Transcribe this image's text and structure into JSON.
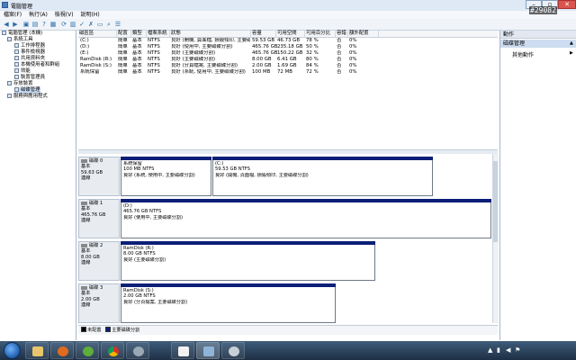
{
  "window": {
    "title": "電腦管理"
  },
  "menubar": [
    "檔案(F)",
    "執行(A)",
    "檢視(V)",
    "說明(H)"
  ],
  "tree": [
    {
      "label": "電腦管理 (本機)",
      "level": 0
    },
    {
      "label": "系統工具",
      "level": 1
    },
    {
      "label": "工作排程器",
      "level": 2
    },
    {
      "label": "事件檢視器",
      "level": 2
    },
    {
      "label": "共用資料夾",
      "level": 2
    },
    {
      "label": "本機使用者和群組",
      "level": 2
    },
    {
      "label": "效能",
      "level": 2
    },
    {
      "label": "裝置管理員",
      "level": 2
    },
    {
      "label": "存放裝置",
      "level": 1
    },
    {
      "label": "磁碟管理",
      "level": 2,
      "selected": true
    },
    {
      "label": "服務與應用程式",
      "level": 1
    }
  ],
  "volumes": {
    "headers": [
      "磁區區",
      "配置",
      "類型",
      "檔案系統",
      "狀態",
      "容量",
      "可用空間",
      "可用百分比",
      "容錯",
      "額外配置"
    ],
    "rows": [
      {
        "name": "(C:)",
        "layout": "簡單",
        "type": "基本",
        "fs": "NTFS",
        "status": "良好 (開機, 頁面檔, 損毀傾印, 主要磁碟分割)",
        "capacity": "59.53 GB",
        "free": "46.73 GB",
        "pct": "78 %",
        "ft": "否",
        "overhead": "0%"
      },
      {
        "name": "(D:)",
        "layout": "簡單",
        "type": "基本",
        "fs": "NTFS",
        "status": "良好 (使用中, 主要磁碟分割)",
        "capacity": "465.76 GB",
        "free": "235.18 GB",
        "pct": "50 %",
        "ft": "否",
        "overhead": "0%"
      },
      {
        "name": "(E:)",
        "layout": "簡單",
        "type": "基本",
        "fs": "NTFS",
        "status": "良好 (主要磁碟分割)",
        "capacity": "465.76 GB",
        "free": "150.22 GB",
        "pct": "32 %",
        "ft": "否",
        "overhead": "0%"
      },
      {
        "name": "RamDisk (R:)",
        "layout": "簡單",
        "type": "基本",
        "fs": "NTFS",
        "status": "良好 (主要磁碟分割)",
        "capacity": "8.00 GB",
        "free": "6.41 GB",
        "pct": "80 %",
        "ft": "否",
        "overhead": "0%"
      },
      {
        "name": "RamDisk (S:)",
        "layout": "簡單",
        "type": "基本",
        "fs": "NTFS",
        "status": "良好 (分頁檔案, 主要磁碟分割)",
        "capacity": "2.00 GB",
        "free": "1.69 GB",
        "pct": "84 %",
        "ft": "否",
        "overhead": "0%"
      },
      {
        "name": "系統保留",
        "layout": "簡單",
        "type": "基本",
        "fs": "NTFS",
        "status": "良好 (系統, 使用中, 主要磁碟分割)",
        "capacity": "100 MB",
        "free": "72 MB",
        "pct": "72 %",
        "ft": "否",
        "overhead": "0%"
      }
    ]
  },
  "disks": [
    {
      "name": "磁碟 0",
      "type": "基本",
      "size": "59.63 GB",
      "state": "連線",
      "parts": [
        {
          "title": "系統保留",
          "size": "100 MB NTFS",
          "status": "良好 (系統, 使用中, 主要磁碟分割)"
        },
        {
          "title": "(C:)",
          "size": "59.53 GB NTFS",
          "status": "良好 (開機, 頁面檔, 損毀傾印, 主要磁碟分割)"
        }
      ]
    },
    {
      "name": "磁碟 1",
      "type": "基本",
      "size": "465.76 GB",
      "state": "連線",
      "parts": [
        {
          "title": "(D:)",
          "size": "465.76 GB NTFS",
          "status": "良好 (使用中, 主要磁碟分割)"
        }
      ]
    },
    {
      "name": "磁碟 2",
      "type": "基本",
      "size": "8.00 GB",
      "state": "連線",
      "parts": [
        {
          "title": "RamDisk  (R:)",
          "size": "8.00 GB NTFS",
          "status": "良好 (主要磁碟分割)"
        }
      ]
    },
    {
      "name": "磁碟 3",
      "type": "基本",
      "size": "2.00 GB",
      "state": "連線",
      "parts": [
        {
          "title": "RamDisk  (S:)",
          "size": "2.00 GB NTFS",
          "status": "良好 (分頁檔案, 主要磁碟分割)"
        }
      ]
    }
  ],
  "legend": {
    "unallocated": "未配置",
    "primary": "主要磁碟分割",
    "colors": {
      "unallocated": "#000000",
      "primary": "#0a1f77"
    }
  },
  "actions": {
    "header": "動作",
    "item": "磁碟管理",
    "more": "其他動作"
  },
  "taskbar": {
    "items": [
      "explorer",
      "firefox",
      "utorrent",
      "chrome",
      "pdf-reader",
      "computer-management",
      "disk-utility"
    ]
  },
  "watermark": "#29082"
}
